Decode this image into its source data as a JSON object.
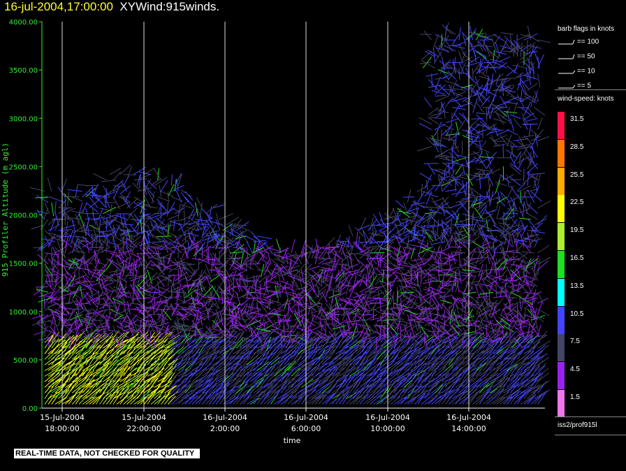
{
  "header": {
    "date_time": "16-jul-2004,17:00:00",
    "product": "XYWind:915winds."
  },
  "warning": "REAL-TIME DATA, NOT CHECKED FOR QUALITY",
  "legend": {
    "barb_title": "barb flags in knots",
    "barbs": [
      {
        "label": "== 100"
      },
      {
        "label": "== 50"
      },
      {
        "label": "== 10"
      },
      {
        "label": "== 5"
      }
    ],
    "speed_title": "wind-speed: knots",
    "colors": [
      {
        "label": "31.5",
        "color": "#ff1144"
      },
      {
        "label": "28.5",
        "color": "#ff7700"
      },
      {
        "label": "25.5",
        "color": "#ffaa00"
      },
      {
        "label": "22.5",
        "color": "#ffff00"
      },
      {
        "label": "19.5",
        "color": "#aaee33"
      },
      {
        "label": "16.5",
        "color": "#22dd22"
      },
      {
        "label": "13.5",
        "color": "#00ffff"
      },
      {
        "label": "10.5",
        "color": "#4444ff"
      },
      {
        "label": "7.5",
        "color": "#444466"
      },
      {
        "label": "4.5",
        "color": "#9922ee"
      },
      {
        "label": "1.5",
        "color": "#ee77ee"
      }
    ],
    "station_id": "iss2/prof915l"
  },
  "chart_data": {
    "type": "scatter",
    "title": "16-jul-2004,17:00:00  XYWind:915winds.",
    "xlabel": "time",
    "ylabel": "915 Profiler Altitude (m agl)",
    "ylim": [
      0,
      4000
    ],
    "xlim": [
      "15-Jul-2004 16:30",
      "16-Jul-2004 17:00"
    ],
    "yticks": [
      "0.00",
      "500.00",
      "1000.00",
      "1500.00",
      "2000.00",
      "2500.00",
      "3000.00",
      "3500.00",
      "4000.00"
    ],
    "xticks": [
      {
        "date": "15-Jul-2004",
        "time": "18:00:00"
      },
      {
        "date": "15-Jul-2004",
        "time": "22:00:00"
      },
      {
        "date": "16-Jul-2004",
        "time": "2:00:00"
      },
      {
        "date": "16-Jul-2004",
        "time": "6:00:00"
      },
      {
        "date": "16-Jul-2004",
        "time": "10:00:00"
      },
      {
        "date": "16-Jul-2004",
        "time": "14:00:00"
      }
    ],
    "grid": "vertical at x ticks",
    "series_note": "wind barbs colored by wind speed",
    "colored_by": "wind-speed: knots"
  }
}
